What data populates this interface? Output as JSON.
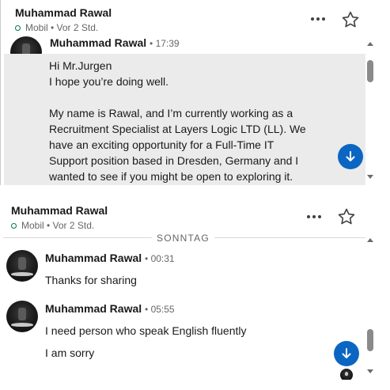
{
  "panel_top": {
    "header": {
      "name": "Muhammad Rawal",
      "status": "Mobil • Vor 2 Std."
    },
    "message": {
      "sender": "Muhammad Rawal",
      "time": "• 17:39",
      "lines": [
        "Hi Mr.Jurgen",
        "I hope you’re doing well.",
        "",
        "My name is Rawal, and I’m currently working as a",
        "Recruitment Specialist at Layers Logic LTD (LL). We",
        "have an exciting opportunity for a Full-Time IT",
        "Support position based in Dresden, Germany and I",
        "wanted to see if you might be open to exploring it."
      ]
    }
  },
  "panel_bottom": {
    "header": {
      "name": "Muhammad Rawal",
      "status": "Mobil • Vor 2 Std."
    },
    "day_label": "SONNTAG",
    "messages": [
      {
        "sender": "Muhammad Rawal",
        "time": "• 00:31",
        "lines": [
          "Thanks for sharing"
        ]
      },
      {
        "sender": "Muhammad Rawal",
        "time": "• 05:55",
        "lines": [
          "I need person who speak English fluently",
          "I am sorry"
        ]
      }
    ]
  },
  "icons": {
    "more": "more-horizontal-icon",
    "star": "star-outline-icon",
    "jump": "arrow-down-icon",
    "presence": "presence-ring-icon"
  },
  "colors": {
    "accent": "#0a66c2",
    "presence": "#057642",
    "message_bg": "#ebebeb"
  }
}
